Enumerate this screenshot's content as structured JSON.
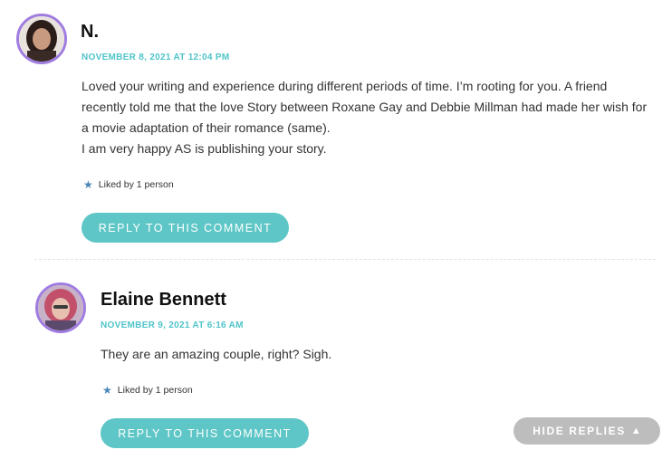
{
  "comments": [
    {
      "author": "N.",
      "date": "NOVEMBER 8, 2021 AT 12:04 PM",
      "paragraphs": [
        "Loved your writing and experience during different periods of time. I’m rooting for you. A friend recently told me that the love Story between Roxane Gay and Debbie Millman had made her wish for a movie adaptation of their romance (same).",
        "I am very happy AS is publishing your story."
      ],
      "liked": "Liked by 1 person",
      "reply_label": "REPLY TO THIS COMMENT"
    },
    {
      "author": "Elaine Bennett",
      "date": "NOVEMBER 9, 2021 AT 6:16 AM",
      "paragraphs": [
        "They are an amazing couple, right? Sigh."
      ],
      "liked": "Liked by 1 person",
      "reply_label": "REPLY TO THIS COMMENT"
    }
  ],
  "hide_replies_label": "HIDE REPLIES",
  "icons": {
    "liked": "star-icon",
    "hide_replies": "triangle-up-icon"
  },
  "colors": {
    "accent": "#4fc4c9",
    "button": "#5ec6c6",
    "avatar_border": "#a07ce0",
    "hide_button": "#bdbdbd"
  }
}
